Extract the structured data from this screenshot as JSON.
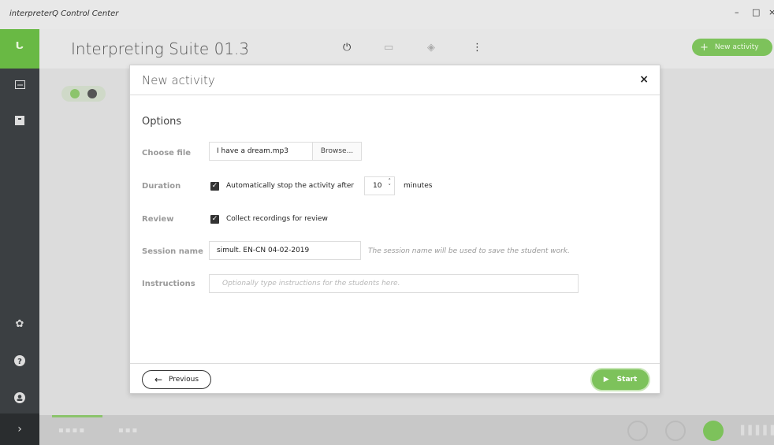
{
  "window": {
    "title": "interpreterQ Control Center",
    "controls": [
      "–",
      "□",
      "×"
    ]
  },
  "app": {
    "title": "Interpreting Suite 01.3",
    "new_activity_label": "New activity",
    "accent_color": "#7dc25b"
  },
  "header_icons": [
    "power-icon",
    "screen-icon",
    "shield-icon",
    "more-icon"
  ],
  "sidebar_icons": [
    "grid-icon",
    "dropbox-icon",
    "gear-icon",
    "help-icon",
    "user-icon",
    "chevron-right-icon"
  ],
  "modal": {
    "title": "New activity",
    "close_label": "×",
    "section_title": "Options",
    "choose_file": {
      "label": "Choose file",
      "value": "I have a dream.mp3",
      "browse_label": "Browse..."
    },
    "duration": {
      "label": "Duration",
      "checked": true,
      "text": "Automatically stop the activity after",
      "minutes_value": "10",
      "unit": "minutes"
    },
    "review": {
      "label": "Review",
      "checked": true,
      "text": "Collect recordings for review"
    },
    "session_name": {
      "label": "Session name",
      "value": "simult. EN-CN 04-02-2019",
      "hint": "The session name will be used to save the student work."
    },
    "instructions": {
      "label": "Instructions",
      "placeholder": "Optionally type instructions for the students here."
    },
    "previous_label": "Previous",
    "start_label": "Start"
  }
}
